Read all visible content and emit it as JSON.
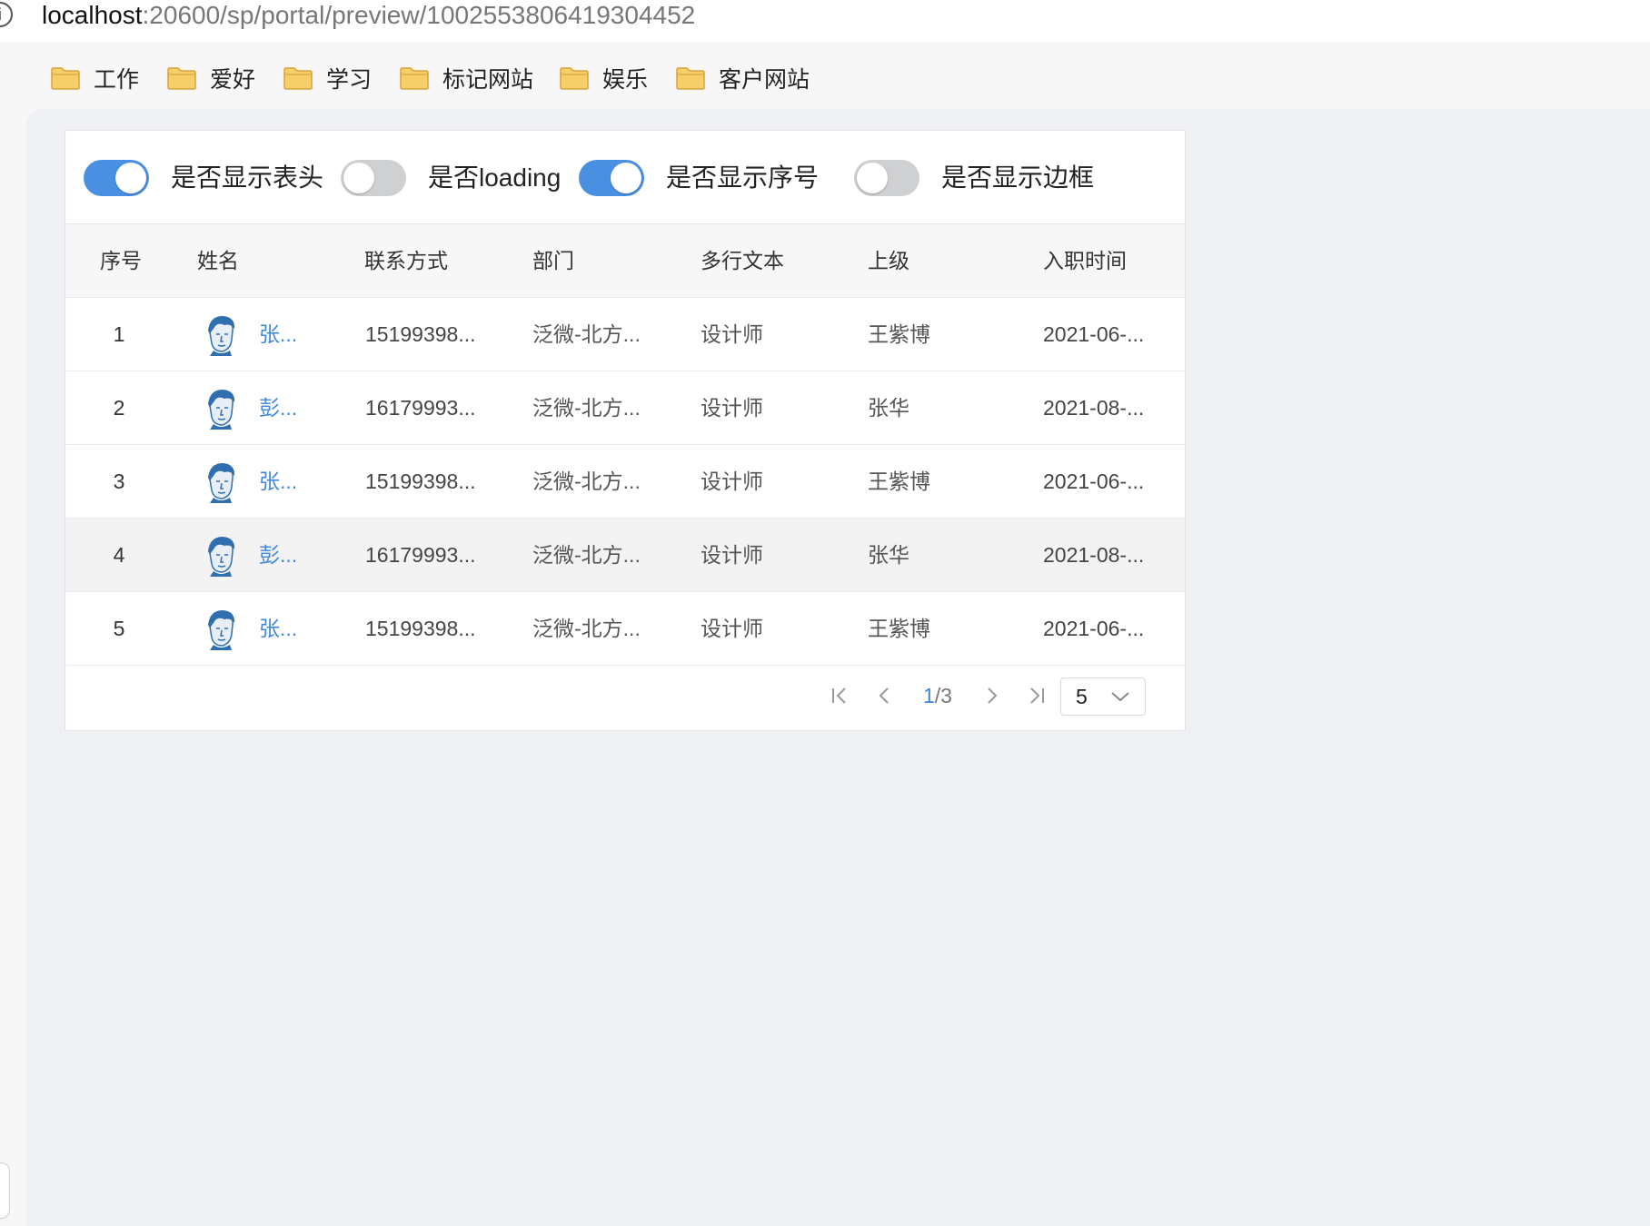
{
  "browser": {
    "url_host": "localhost",
    "url_rest": ":20600/sp/portal/preview/1002553806419304452"
  },
  "bookmarks": [
    {
      "label": "工作",
      "icon": "folder-icon"
    },
    {
      "label": "爱好",
      "icon": "folder-icon"
    },
    {
      "label": "学习",
      "icon": "folder-icon"
    },
    {
      "label": "标记网站",
      "icon": "folder-icon"
    },
    {
      "label": "娱乐",
      "icon": "folder-icon"
    },
    {
      "label": "客户网站",
      "icon": "folder-icon"
    }
  ],
  "toggles": [
    {
      "label": "是否显示表头",
      "on": true
    },
    {
      "label": "是否loading",
      "on": false
    },
    {
      "label": "是否显示序号",
      "on": true
    },
    {
      "label": "是否显示边框",
      "on": false
    }
  ],
  "table": {
    "headers": [
      "序号",
      "姓名",
      "联系方式",
      "部门",
      "多行文本",
      "上级",
      "入职时间"
    ],
    "rows": [
      {
        "idx": "1",
        "name": "张...",
        "phone": "15199398...",
        "dept": "泛微-北方...",
        "text": "设计师",
        "boss": "王紫博",
        "date": "2021-06-..."
      },
      {
        "idx": "2",
        "name": "彭...",
        "phone": "16179993...",
        "dept": "泛微-北方...",
        "text": "设计师",
        "boss": "张华",
        "date": "2021-08-..."
      },
      {
        "idx": "3",
        "name": "张...",
        "phone": "15199398...",
        "dept": "泛微-北方...",
        "text": "设计师",
        "boss": "王紫博",
        "date": "2021-06-..."
      },
      {
        "idx": "4",
        "name": "彭...",
        "phone": "16179993...",
        "dept": "泛微-北方...",
        "text": "设计师",
        "boss": "张华",
        "date": "2021-08-..."
      },
      {
        "idx": "5",
        "name": "张...",
        "phone": "15199398...",
        "dept": "泛微-北方...",
        "text": "设计师",
        "boss": "王紫博",
        "date": "2021-06-..."
      }
    ]
  },
  "pagination": {
    "current": "1",
    "sep_total": "/3",
    "page_size": "5"
  },
  "colors": {
    "accent": "#4a90e2",
    "link": "#3f86d8",
    "folder": "#f5c451"
  }
}
